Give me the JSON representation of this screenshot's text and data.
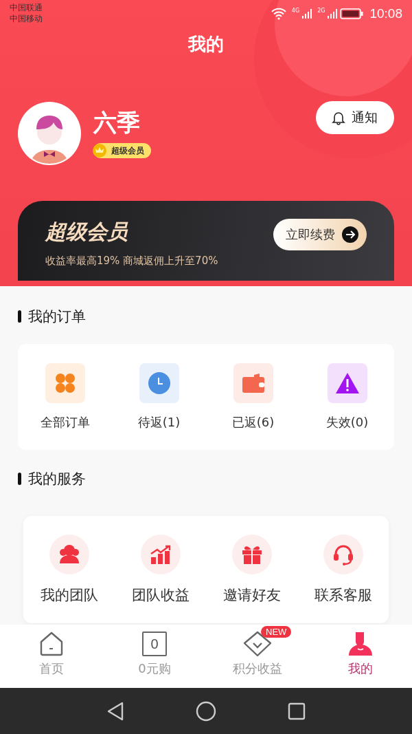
{
  "status_bar": {
    "carriers": [
      "中国联通",
      "中国移动"
    ],
    "network_labels": [
      "4G",
      "2G"
    ],
    "time": "10:08"
  },
  "header": {
    "title": "我的"
  },
  "profile": {
    "name": "六季",
    "badge": "超级会员",
    "notify_button": "通知"
  },
  "member_card": {
    "title": "超级会员",
    "subtitle": "收益率最高19%  商城返佣上升至70%",
    "button": "立即续费"
  },
  "orders": {
    "heading": "我的订单",
    "items": [
      {
        "kind": "all",
        "label": "全部订单",
        "color": "#f5841f"
      },
      {
        "kind": "pending",
        "label": "待返(1)",
        "color": "#4a8fe0"
      },
      {
        "kind": "returned",
        "label": "已返(6)",
        "color": "#f2674e"
      },
      {
        "kind": "invalid",
        "label": "失效(0)",
        "color": "#a214f0"
      }
    ]
  },
  "services": {
    "heading": "我的服务",
    "items": [
      {
        "kind": "team",
        "label": "我的团队"
      },
      {
        "kind": "earnings",
        "label": "团队收益"
      },
      {
        "kind": "invite",
        "label": "邀请好友"
      },
      {
        "kind": "support",
        "label": "联系客服"
      }
    ]
  },
  "tab_bar": [
    {
      "kind": "home",
      "label": "首页",
      "selected": false
    },
    {
      "kind": "free",
      "label": "0元购",
      "icon_text": "0",
      "selected": false
    },
    {
      "kind": "points",
      "label": "积分收益",
      "badge": "NEW",
      "selected": false
    },
    {
      "kind": "me",
      "label": "我的",
      "selected": true
    }
  ]
}
